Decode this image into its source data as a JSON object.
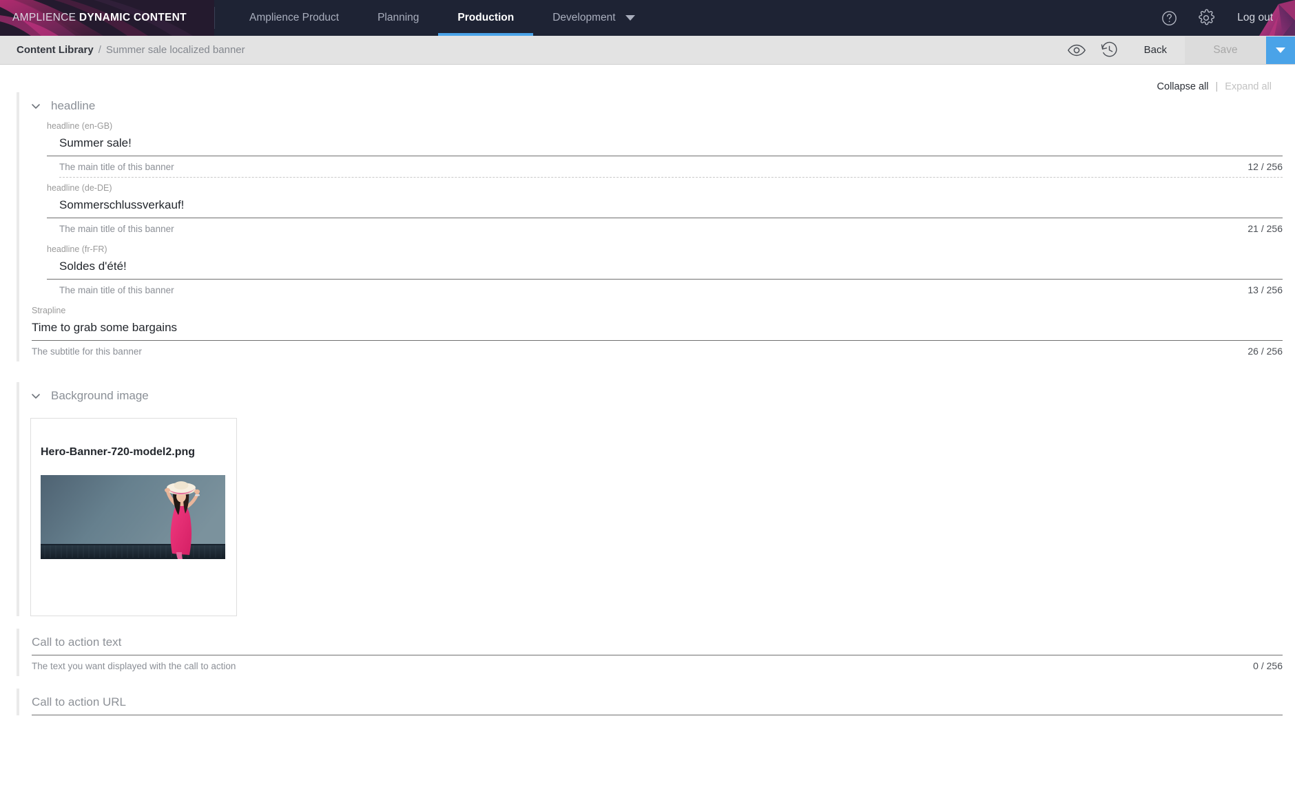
{
  "brand": {
    "logo_light": "AMPLIENCE",
    "logo_bold": "DYNAMIC CONTENT",
    "accent_blue": "#4aa3e8",
    "nav_bg": "#1e2334",
    "magenta": "#b92a6f"
  },
  "nav": {
    "items": [
      {
        "label": "Amplience Product",
        "active": false
      },
      {
        "label": "Planning",
        "active": false
      },
      {
        "label": "Production",
        "active": true
      },
      {
        "label": "Development",
        "active": false
      }
    ],
    "caret_icon": "chevron-down-icon",
    "help_icon": "help-circle-icon",
    "settings_icon": "gear-icon",
    "logout_label": "Log out"
  },
  "breadcrumb": {
    "root": "Content Library",
    "separator": "/",
    "current": "Summer sale localized banner"
  },
  "toolbar": {
    "preview_icon": "eye-icon",
    "history_icon": "history-clock-icon",
    "back_label": "Back",
    "save_label": "Save",
    "save_disabled": true,
    "save_dropdown_icon": "chevron-down-icon"
  },
  "tree_controls": {
    "collapse_all": "Collapse all",
    "pipe": "|",
    "expand_all": "Expand all"
  },
  "sections": {
    "headline": {
      "title": "headline",
      "chevron_icon": "chevron-down-icon",
      "fields": [
        {
          "label": "headline (en-GB)",
          "value": "Summer sale!",
          "help": "The main title of this banner",
          "count": "12 / 256"
        },
        {
          "label": "headline (de-DE)",
          "value": "Sommerschlussverkauf!",
          "help": "The main title of this banner",
          "count": "21 / 256"
        },
        {
          "label": "headline (fr-FR)",
          "value": "Soldes d'été!",
          "help": "The main title of this banner",
          "count": "13 / 256"
        }
      ]
    },
    "strapline": {
      "label": "Strapline",
      "value": "Time to grab some bargains",
      "help": "The subtitle for this banner",
      "count": "26 / 256"
    },
    "background_image": {
      "title": "Background image",
      "chevron_icon": "chevron-down-icon",
      "asset_name": "Hero-Banner-720-model2.png"
    },
    "cta_text": {
      "placeholder": "Call to action text",
      "value": "",
      "help": "The text you want displayed with the call to action",
      "count": "0 / 256"
    },
    "cta_url": {
      "placeholder": "Call to action URL",
      "value": ""
    }
  }
}
